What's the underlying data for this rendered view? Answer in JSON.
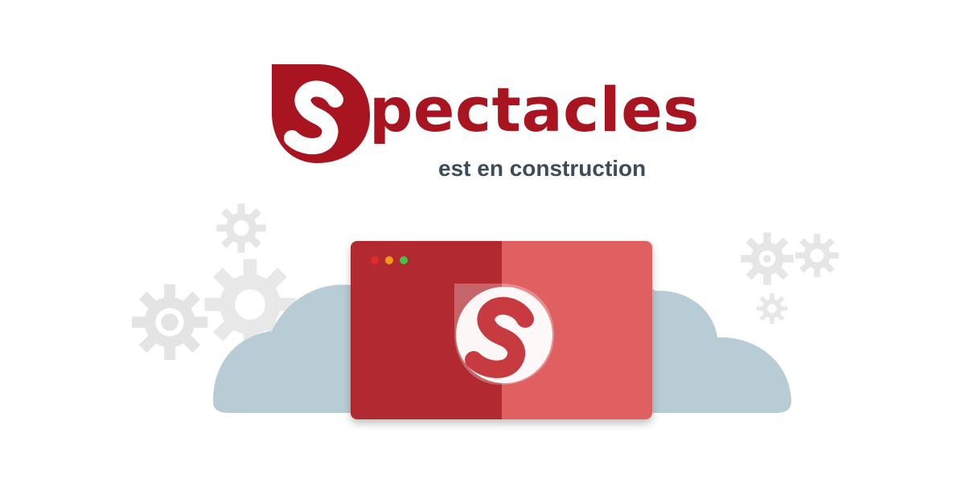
{
  "brand": {
    "name": "pectacles",
    "logo_letter": "S",
    "primary_color": "#a8141f"
  },
  "tagline": "est en construction",
  "illustration": {
    "window_dots": [
      "red",
      "yellow",
      "green"
    ],
    "window_left_color": "#b02a30",
    "window_right_color": "#e06062",
    "cloud_color": "#b8ccd6",
    "gear_color": "#e6e6e6",
    "icons": [
      "gear-icon",
      "cloud-icon",
      "browser-window-icon",
      "spectacles-logo-icon"
    ]
  }
}
